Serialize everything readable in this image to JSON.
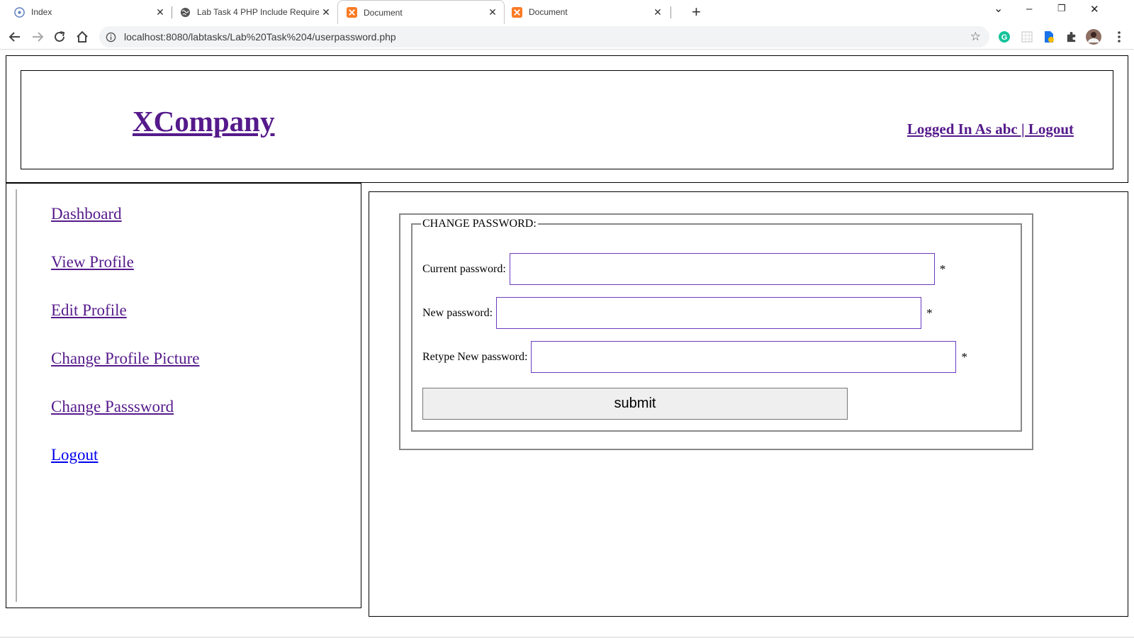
{
  "browser": {
    "tabs": [
      {
        "title": "Index",
        "icon": "compass-icon"
      },
      {
        "title": "Lab Task 4 PHP Include Require w",
        "icon": "globe-icon"
      },
      {
        "title": "Document",
        "icon": "xampp-icon",
        "active": true
      },
      {
        "title": "Document",
        "icon": "xampp-icon"
      }
    ],
    "new_tab": "+",
    "url": "localhost:8080/labtasks/Lab%20Task%204/userpassword.php"
  },
  "header": {
    "logo": "XCompany",
    "login_text": "Logged In As abc | Logout"
  },
  "sidebar": {
    "items": [
      {
        "label": "Dashboard"
      },
      {
        "label": "View Profile"
      },
      {
        "label": "Edit Profile"
      },
      {
        "label": "Change Profile Picture"
      },
      {
        "label": "Change Passsword"
      },
      {
        "label": "Logout"
      }
    ]
  },
  "form": {
    "legend": "CHANGE PASSWORD:",
    "fields": [
      {
        "label": "Current password:",
        "value": "",
        "required_mark": "*"
      },
      {
        "label": "New password:",
        "value": "",
        "required_mark": "*"
      },
      {
        "label": "Retype New password:",
        "value": "",
        "required_mark": "*"
      }
    ],
    "submit_label": "submit"
  },
  "colors": {
    "visited_link": "#551a8b",
    "unvisited_link": "#0000ee",
    "input_border": "#6a3cc0"
  }
}
